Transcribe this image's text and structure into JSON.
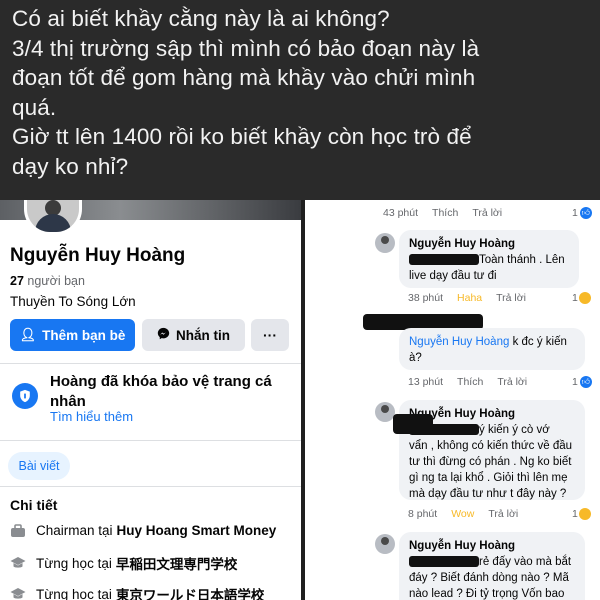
{
  "caption": {
    "line1": "Có ai biết khầy cằng này là ai không?",
    "line2": "3/4 thị trường sập thì mình có bảo đoạn này là",
    "line3": "đoạn tốt để gom hàng mà khầy vào chửi mình",
    "line4": "quá.",
    "line5": "Giờ tt lên 1400 rồi ko biết khầy còn học trò để",
    "line6": "dạy ko nhỉ?"
  },
  "profile": {
    "name": "Nguyễn Huy Hoàng",
    "friends_count": "27",
    "friends_label": "người bạn",
    "bio": "Thuyền To Sóng Lớn",
    "add_friend_label": "Thêm bạn bè",
    "message_label": "Nhắn tin",
    "more_label": "···",
    "lock_title": "Hoàng đã khóa bảo vệ trang cá nhân",
    "lock_link": "Tìm hiểu thêm",
    "posts_tab": "Bài viết",
    "details_title": "Chi tiết",
    "details": [
      {
        "prefix": "Chairman tại",
        "value": "Huy Hoang Smart Money"
      },
      {
        "prefix": "Từng học tại",
        "value": "早稲田文理専門学校"
      },
      {
        "prefix": "Từng học tại",
        "value": "東京ワールド日本語学校"
      }
    ]
  },
  "comments": {
    "top_meta": {
      "time": "43 phút",
      "like": "Thích",
      "reply": "Trả lời",
      "count": "1"
    },
    "items": [
      {
        "author": "Nguyễn Huy Hoàng",
        "lines": [
          "Toàn thánh . Lên",
          "live dạy đầu tư đi"
        ],
        "time": "38 phút",
        "reaction": "Haha",
        "reply": "Trả lời",
        "count": "1"
      },
      {
        "mention": "Nguyễn Huy Hoàng",
        "lines": [
          "k đc ý kiến",
          "à?"
        ],
        "time": "13 phút",
        "like": "Thích",
        "reply": "Trả lời",
        "count": "1"
      },
      {
        "author": "Nguyễn Huy Hoàng",
        "lines": [
          "ý kiến ý cò vớ",
          "vẩn , không có kiến thức về đầu",
          "tư thì đừng có phán . Ng ko biết",
          "gì ng ta lại khổ . Giỏi thì lên mẹ",
          "mà dạy đầu tư như t đây này ?"
        ],
        "time": "8 phút",
        "reaction": "Wow",
        "reply": "Trả lời",
        "count": "1"
      },
      {
        "author": "Nguyễn Huy Hoàng",
        "lines": [
          "rẻ đấy vào mà bắt",
          "đáy ? Biết đánh dòng nào ? Mã",
          "nào lead ? Đi tỷ trọng Vốn bao"
        ]
      }
    ]
  },
  "colors": {
    "brand": "#1877f2",
    "haha": "#f7b928",
    "caption_bg": "#2a2a2a"
  }
}
